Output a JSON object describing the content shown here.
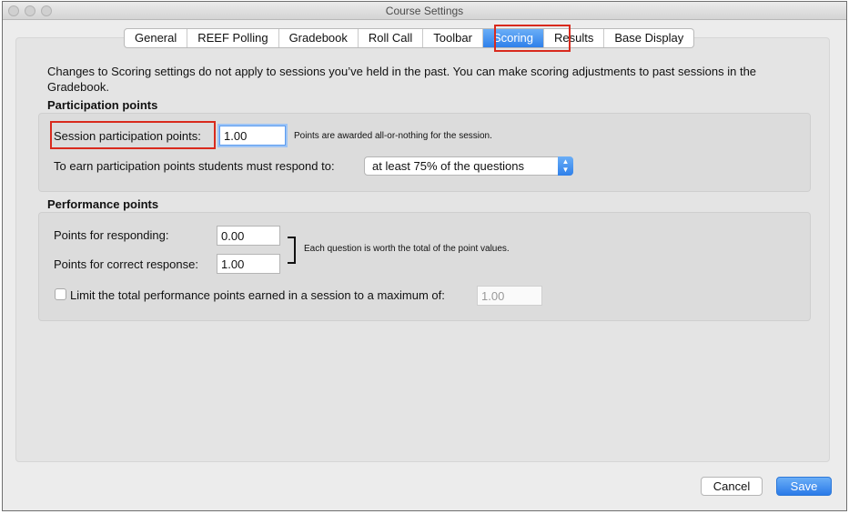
{
  "window": {
    "title": "Course Settings"
  },
  "tabs": [
    {
      "label": "General",
      "active": false
    },
    {
      "label": "REEF Polling",
      "active": false
    },
    {
      "label": "Gradebook",
      "active": false
    },
    {
      "label": "Roll Call",
      "active": false
    },
    {
      "label": "Toolbar",
      "active": false
    },
    {
      "label": "Scoring",
      "active": true
    },
    {
      "label": "Results",
      "active": false
    },
    {
      "label": "Base Display",
      "active": false
    }
  ],
  "intro_text": "Changes to Scoring settings do not apply to sessions you’ve held in the past. You can make scoring adjustments to past sessions in the Gradebook.",
  "participation": {
    "title": "Participation points",
    "session_points_label": "Session participation points:",
    "session_points_value": "1.00",
    "session_points_note": "Points are awarded all-or-nothing for the session.",
    "respond_label": "To earn participation points students must respond to:",
    "respond_selected": "at least 75% of the questions"
  },
  "performance": {
    "title": "Performance points",
    "responding_label": "Points for responding:",
    "responding_value": "0.00",
    "correct_label": "Points for correct response:",
    "correct_value": "1.00",
    "bracket_note": "Each question is worth the total of the point values.",
    "limit_label": "Limit the total performance points earned in a session to a maximum of:",
    "limit_checked": false,
    "limit_value": "1.00"
  },
  "buttons": {
    "cancel": "Cancel",
    "save": "Save"
  },
  "colors": {
    "accent": "#2f80ea",
    "highlight": "#d92a1d",
    "panel": "#e4e4e4"
  }
}
